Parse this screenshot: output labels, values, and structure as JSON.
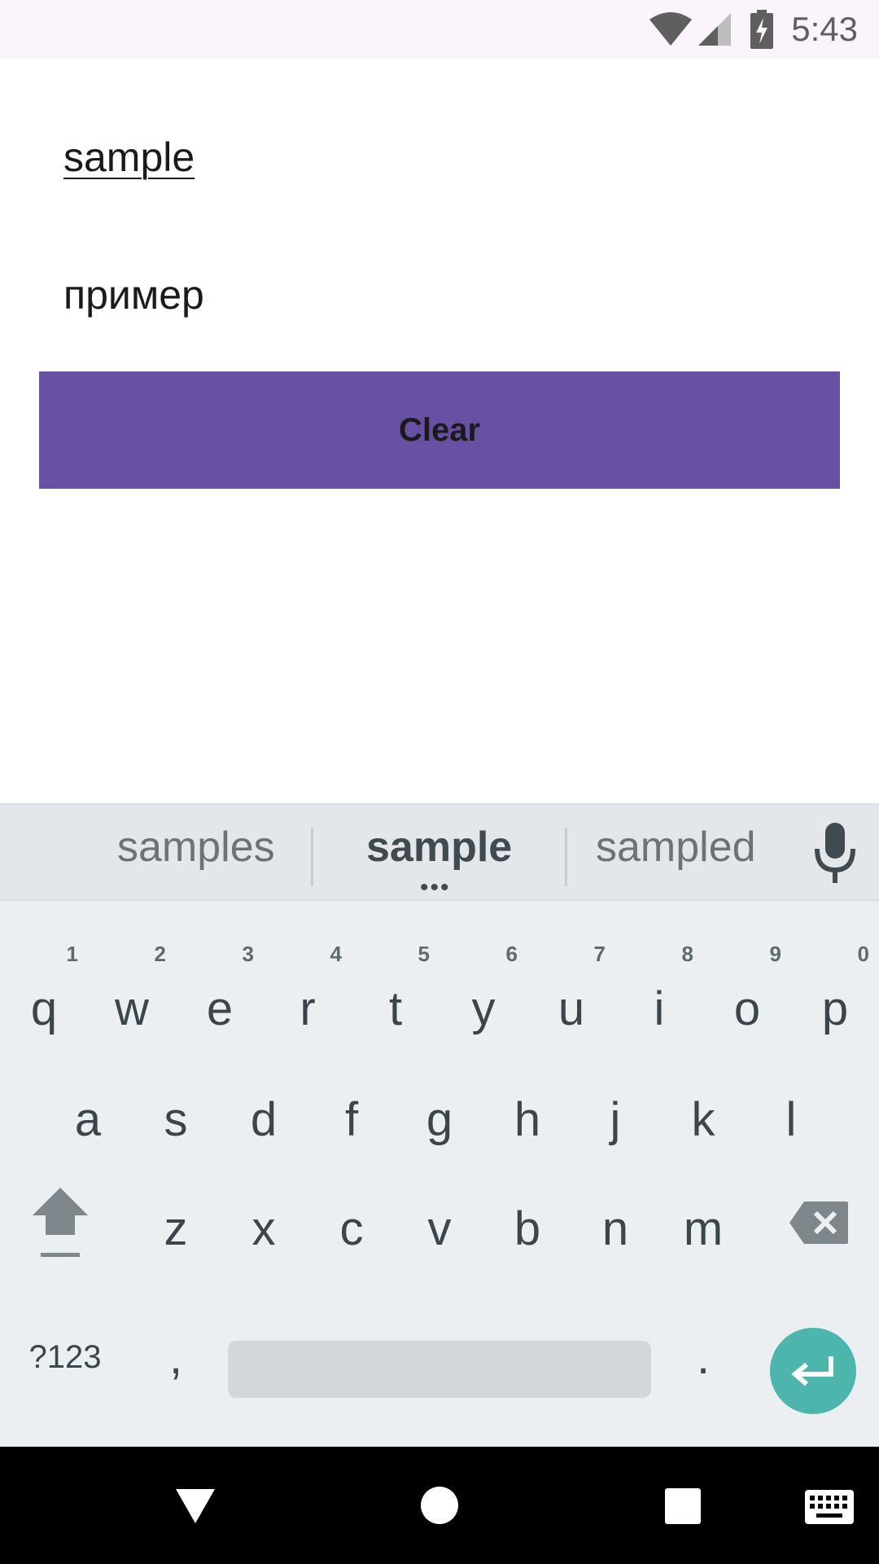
{
  "status_bar": {
    "time": "5:43",
    "icons": [
      "wifi-icon",
      "cell-signal-icon",
      "battery-charging-icon"
    ]
  },
  "content": {
    "input_text": "sample",
    "translation": "пример",
    "clear_label": "Clear",
    "button_color": "#6750a4"
  },
  "keyboard": {
    "suggestions": [
      "samples",
      "sample",
      "sampled"
    ],
    "row1": [
      {
        "key": "q",
        "hint": "1"
      },
      {
        "key": "w",
        "hint": "2"
      },
      {
        "key": "e",
        "hint": "3"
      },
      {
        "key": "r",
        "hint": "4"
      },
      {
        "key": "t",
        "hint": "5"
      },
      {
        "key": "y",
        "hint": "6"
      },
      {
        "key": "u",
        "hint": "7"
      },
      {
        "key": "i",
        "hint": "8"
      },
      {
        "key": "o",
        "hint": "9"
      },
      {
        "key": "p",
        "hint": "0"
      }
    ],
    "row2": [
      "a",
      "s",
      "d",
      "f",
      "g",
      "h",
      "j",
      "k",
      "l"
    ],
    "row3": [
      "z",
      "x",
      "c",
      "v",
      "b",
      "n",
      "m"
    ],
    "symbols_label": "?123",
    "comma": ",",
    "period": ".",
    "enter_color": "#4db6ac"
  },
  "nav_bar": {
    "icons": [
      "back-icon",
      "home-icon",
      "recents-icon",
      "keyboard-switch-icon"
    ]
  }
}
